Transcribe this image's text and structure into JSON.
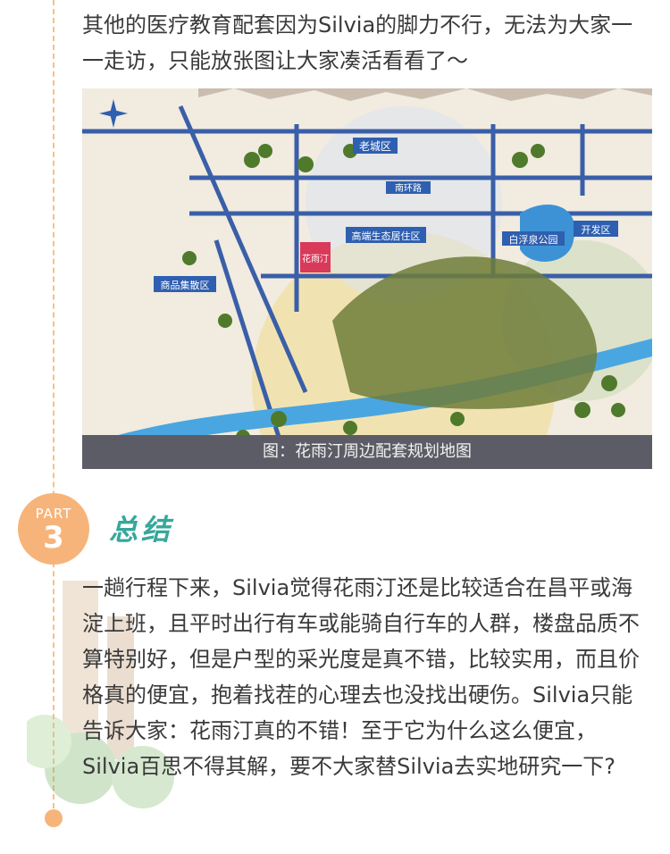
{
  "intro_text": "其他的医疗教育配套因为Silvia的脚力不行，无法为大家一一走访，只能放张图让大家凑活看看了～",
  "map": {
    "caption": "图：花雨汀周边配套规划地图",
    "labels": {
      "old_town": "老城区",
      "gaoya": "高端生态居住区",
      "commerce": "商品集散区",
      "development": "开发区",
      "lake_park": "白浮泉公园",
      "project": "花雨汀",
      "ring_road": "南环路"
    }
  },
  "part": {
    "label": "PART",
    "number": "3"
  },
  "section_title": "总结",
  "summary_text": "一趟行程下来，Silvia觉得花雨汀还是比较适合在昌平或海淀上班，且平时出行有车或能骑自行车的人群，楼盘品质不算特别好，但是户型的采光度是真不错，比较实用，而且价格真的便宜，抱着找茬的心理去也没找出硬伤。Silvia只能告诉大家：花雨汀真的不错！至于它为什么这么便宜，Silvia百思不得其解，要不大家替Silvia去实地研究一下?",
  "colors": {
    "accent_orange": "#f7b47a",
    "title_green": "#36a79b",
    "caption_bg": "#5c5c66"
  }
}
